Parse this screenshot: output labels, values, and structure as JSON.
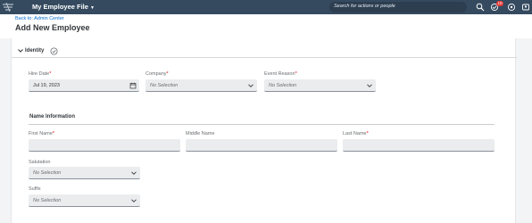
{
  "shell": {
    "app_title": "My Employee File",
    "search_placeholder": "Search for actions or people",
    "notification_count": "10"
  },
  "header": {
    "breadcrumb": "Back to: Admin Center",
    "title": "Add New Employee"
  },
  "section": {
    "title": "Identity"
  },
  "fields": {
    "hire_date": {
      "label": "Hire Date",
      "required": "*",
      "value": "Jul 19, 2023"
    },
    "company": {
      "label": "Company",
      "required": "*",
      "value": "No Selection"
    },
    "event_reason": {
      "label": "Event Reason",
      "required": "*",
      "value": "No Selection"
    }
  },
  "name_info": {
    "title": "Name Information",
    "first_name": {
      "label": "First Name",
      "required": "*",
      "value": ""
    },
    "middle_name": {
      "label": "Middle Name",
      "value": ""
    },
    "last_name": {
      "label": "Last Name",
      "required": "*",
      "value": ""
    },
    "salutation": {
      "label": "Salutation",
      "value": "No Selection"
    },
    "suffix": {
      "label": "Suffix",
      "value": "No Selection"
    }
  },
  "colors": {
    "shell": "#354a5f",
    "link": "#0a6ed1",
    "field_bg": "#eaecee",
    "required": "#ee0000",
    "badge": "#e53935"
  }
}
